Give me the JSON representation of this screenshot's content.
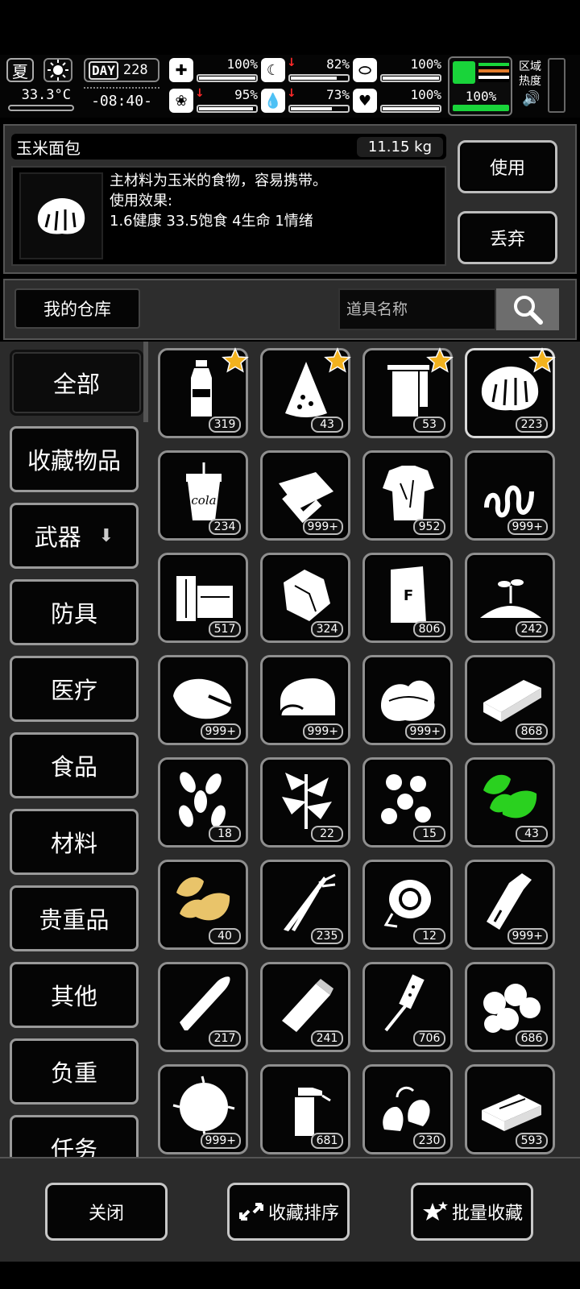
{
  "hud": {
    "season": "夏",
    "temperature": "33.3°C",
    "day_label": "DAY",
    "day": "228",
    "time": "-08:40-",
    "stats": [
      {
        "name": "health",
        "icon": "medkit-icon",
        "value": "100%",
        "level": 1.0,
        "down": false
      },
      {
        "name": "hunger",
        "icon": "stomach-icon",
        "value": "82%",
        "level": 0.82,
        "down": true
      },
      {
        "name": "stamina",
        "icon": "pill-icon",
        "value": "100%",
        "level": 1.0,
        "down": false
      },
      {
        "name": "mood",
        "icon": "brain-icon",
        "value": "95%",
        "level": 0.95,
        "down": true
      },
      {
        "name": "thirst",
        "icon": "water-drop-icon",
        "value": "73%",
        "level": 0.73,
        "down": true
      },
      {
        "name": "life",
        "icon": "heart-icon",
        "value": "100%",
        "level": 1.0,
        "down": false
      }
    ],
    "load": {
      "value": "100%",
      "level": 1.0,
      "color": "#19d43a"
    },
    "zone_label": "区域热度"
  },
  "detail": {
    "name": "玉米面包",
    "weight": "11.15 kg",
    "desc_line1": "主材料为玉米的食物，容易携带。",
    "desc_line2": "使用效果:",
    "desc_line3": "1.6健康 33.5饱食 4生命 1情绪",
    "use_label": "使用",
    "drop_label": "丢弃"
  },
  "warehouse": {
    "title": "我的仓库",
    "search_placeholder": "道具名称"
  },
  "categories": [
    {
      "label": "全部",
      "active": true
    },
    {
      "label": "收藏物品"
    },
    {
      "label": "武器",
      "expand": true
    },
    {
      "label": "防具"
    },
    {
      "label": "医疗"
    },
    {
      "label": "食品"
    },
    {
      "label": "材料"
    },
    {
      "label": "贵重品"
    },
    {
      "label": "其他"
    },
    {
      "label": "负重"
    },
    {
      "label": "任务"
    }
  ],
  "items": [
    {
      "icon": "water-bottle-icon",
      "count": "319",
      "favorite": true
    },
    {
      "icon": "watermelon-slice-icon",
      "count": "43",
      "favorite": true
    },
    {
      "icon": "towel-icon",
      "count": "53",
      "favorite": true
    },
    {
      "icon": "corn-bread-icon",
      "count": "223",
      "favorite": true,
      "selected": true
    },
    {
      "icon": "cola-cup-icon",
      "count": "234",
      "label": "cola"
    },
    {
      "icon": "cloth-icon",
      "count": "999+"
    },
    {
      "icon": "torn-shirt-icon",
      "count": "952"
    },
    {
      "icon": "spring-icon",
      "count": "999+"
    },
    {
      "icon": "wood-planks-icon",
      "count": "517"
    },
    {
      "icon": "rock-icon",
      "count": "324"
    },
    {
      "icon": "fertilizer-bag-icon",
      "count": "806",
      "label": "F"
    },
    {
      "icon": "soil-sprout-icon",
      "count": "242"
    },
    {
      "icon": "meat-chunk-icon",
      "count": "999+"
    },
    {
      "icon": "folded-fabric-icon",
      "count": "999+"
    },
    {
      "icon": "cotton-pile-icon",
      "count": "999+"
    },
    {
      "icon": "board-icon",
      "count": "868"
    },
    {
      "icon": "seeds-icon",
      "count": "18"
    },
    {
      "icon": "herb-plant-icon",
      "count": "22"
    },
    {
      "icon": "mushrooms-icon",
      "count": "15"
    },
    {
      "icon": "green-leaves-icon",
      "count": "43",
      "color": "#2ad11f"
    },
    {
      "icon": "yellow-leaves-icon",
      "count": "40",
      "color": "#e9c46a"
    },
    {
      "icon": "scallion-icon",
      "count": "235"
    },
    {
      "icon": "gas-mask-filter-icon",
      "count": "12"
    },
    {
      "icon": "milk-bottle-icon",
      "count": "999+"
    },
    {
      "icon": "bullet-icon",
      "count": "217"
    },
    {
      "icon": "battery-icon",
      "count": "241"
    },
    {
      "icon": "water-filter-icon",
      "count": "706"
    },
    {
      "icon": "potatoes-icon",
      "count": "686"
    },
    {
      "icon": "fur-ball-icon",
      "count": "999+"
    },
    {
      "icon": "spray-bottle-icon",
      "count": "681"
    },
    {
      "icon": "earplugs-icon",
      "count": "230"
    },
    {
      "icon": "cash-stack-icon",
      "count": "593"
    }
  ],
  "footer": {
    "close_label": "关闭",
    "sort_label": "收藏排序",
    "batch_label": "批量收藏"
  },
  "colors": {
    "star": "#f2b21e",
    "accent_green": "#19d43a",
    "panel": "#2b2b2b"
  }
}
